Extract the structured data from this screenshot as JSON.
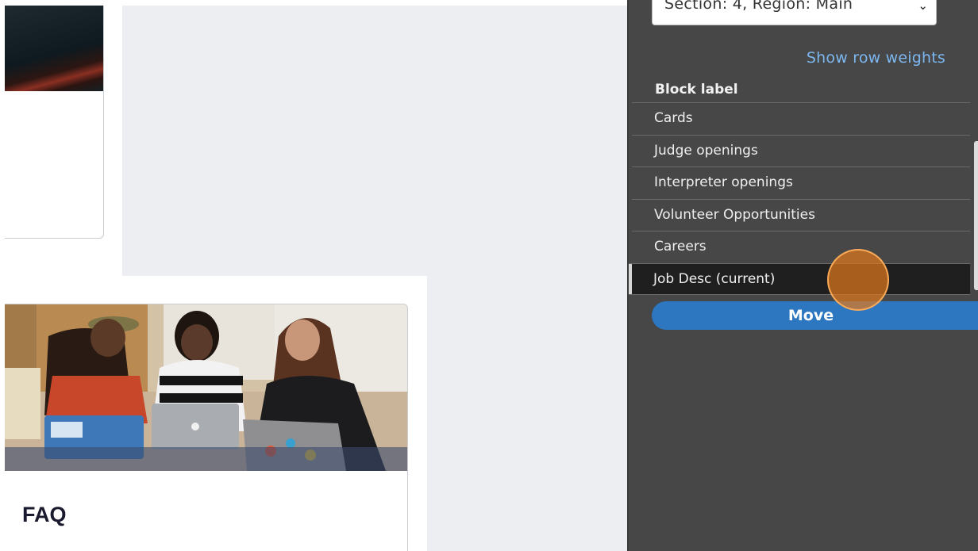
{
  "region_select": {
    "value": "Section: 4, Region: Main"
  },
  "panel": {
    "row_weights_link": "Show row weights",
    "block_label_header": "Block label",
    "blocks": [
      {
        "label": "Cards"
      },
      {
        "label": "Judge openings"
      },
      {
        "label": "Interpreter openings"
      },
      {
        "label": "Volunteer Opportunities"
      },
      {
        "label": "Careers"
      },
      {
        "label": "Job Desc (current)"
      }
    ],
    "move_button": "Move"
  },
  "cards": {
    "faq_title": "FAQ"
  },
  "colors": {
    "panel_bg": "#474747",
    "link": "#7cb7f0",
    "move_button": "#2d77c0",
    "current_row_bg": "#1f1f1f",
    "click_indicator": "#de781e"
  }
}
